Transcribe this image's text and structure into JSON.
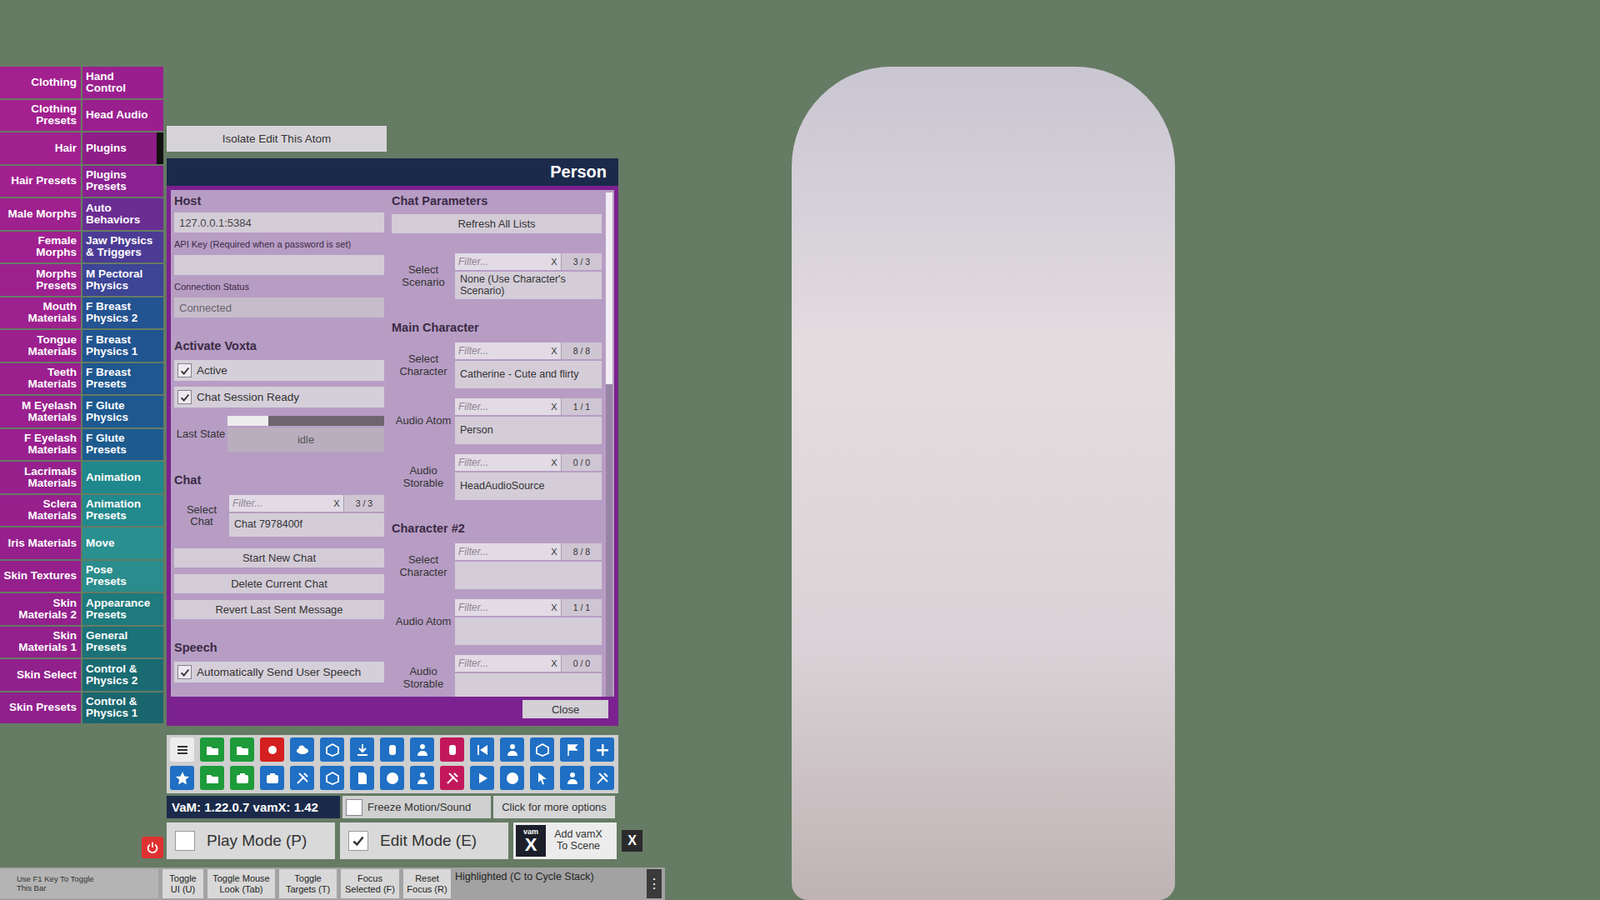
{
  "tabs": {
    "left": [
      {
        "label": "Clothing",
        "selected": false,
        "color": "#a3208f"
      },
      {
        "label": "Clothing Presets",
        "selected": false,
        "color": "#a3208f"
      },
      {
        "label": "Hair",
        "selected": false,
        "color": "#a1208f"
      },
      {
        "label": "Hair Presets",
        "selected": false,
        "color": "#a1208f"
      },
      {
        "label": "Male Morphs",
        "selected": false,
        "color": "#9f208f"
      },
      {
        "label": "Female Morphs",
        "selected": false,
        "color": "#9f208f"
      },
      {
        "label": "Morphs Presets",
        "selected": false,
        "color": "#9d208f"
      },
      {
        "label": "Mouth Materials",
        "selected": false,
        "color": "#9d208f"
      },
      {
        "label": "Tongue Materials",
        "selected": false,
        "color": "#9b208e"
      },
      {
        "label": "Teeth Materials",
        "selected": false,
        "color": "#9b208e"
      },
      {
        "label": "M Eyelash Materials",
        "selected": false,
        "color": "#99208e"
      },
      {
        "label": "F Eyelash Materials",
        "selected": false,
        "color": "#99208e"
      },
      {
        "label": "Lacrimals Materials",
        "selected": false,
        "color": "#97208d"
      },
      {
        "label": "Sclera Materials",
        "selected": false,
        "color": "#97208d"
      },
      {
        "label": "Iris Materials",
        "selected": false,
        "color": "#95208d"
      },
      {
        "label": "Skin Textures",
        "selected": false,
        "color": "#95208d"
      },
      {
        "label": "Skin Materials 2",
        "selected": false,
        "color": "#93208c"
      },
      {
        "label": "Skin Materials 1",
        "selected": false,
        "color": "#93208c"
      },
      {
        "label": "Skin Select",
        "selected": false,
        "color": "#91208c"
      },
      {
        "label": "Skin Presets",
        "selected": false,
        "color": "#91208c"
      }
    ],
    "right": [
      {
        "label": "Hand Control",
        "selected": false,
        "color": "#9a1f8e"
      },
      {
        "label": "Head Audio",
        "selected": false,
        "color": "#9a1f8e"
      },
      {
        "label": "Plugins",
        "selected": true,
        "color": "#8e1d88"
      },
      {
        "label": "Plugins Presets",
        "selected": false,
        "color": "#8a2190"
      },
      {
        "label": "Auto Behaviors",
        "selected": false,
        "color": "#6a2d92"
      },
      {
        "label": "Jaw Physics & Triggers",
        "selected": false,
        "color": "#4c3b95"
      },
      {
        "label": "M Pectoral Physics",
        "selected": false,
        "color": "#3c4596"
      },
      {
        "label": "F Breast Physics 2",
        "selected": false,
        "color": "#245391"
      },
      {
        "label": "F Breast Physics 1",
        "selected": false,
        "color": "#215591"
      },
      {
        "label": "F Breast Presets",
        "selected": false,
        "color": "#1f5790"
      },
      {
        "label": "F Glute Physics",
        "selected": false,
        "color": "#1d598f"
      },
      {
        "label": "F Glute Presets",
        "selected": false,
        "color": "#1d5b8f"
      },
      {
        "label": "Animation",
        "selected": false,
        "color": "#1f888c"
      },
      {
        "label": "Animation Presets",
        "selected": false,
        "color": "#22898c"
      },
      {
        "label": "Move",
        "selected": false,
        "color": "#2a8f8f"
      },
      {
        "label": "Pose Presets",
        "selected": false,
        "color": "#2a8c8c"
      },
      {
        "label": "Appearance Presets",
        "selected": false,
        "color": "#1e7a7c"
      },
      {
        "label": "General Presets",
        "selected": false,
        "color": "#1c7277"
      },
      {
        "label": "Control & Physics 2",
        "selected": false,
        "color": "#1a6a71"
      },
      {
        "label": "Control & Physics 1",
        "selected": false,
        "color": "#1a666e"
      }
    ]
  },
  "isolate_button": "Isolate Edit This Atom",
  "panel": {
    "title": "Person",
    "scrollbar": {
      "level": 0.38
    },
    "close": "Close",
    "left": [
      {
        "kind": "heading",
        "text": "Host"
      },
      {
        "kind": "field",
        "value": "127.0.0.1:5384",
        "disabled": false
      },
      {
        "kind": "caption",
        "text": "API Key (Required when a password is set)"
      },
      {
        "kind": "field",
        "value": "",
        "disabled": false
      },
      {
        "kind": "caption",
        "text": "Connection Status"
      },
      {
        "kind": "field",
        "value": "Connected",
        "disabled": true
      },
      {
        "kind": "heading",
        "text": "Activate Voxta"
      },
      {
        "kind": "checkbox",
        "label": "Active",
        "checked": true
      },
      {
        "kind": "checkbox",
        "label": "Chat Session Ready",
        "checked": true
      },
      {
        "kind": "slider",
        "label": "Last State",
        "level": 0.26,
        "value": "idle"
      },
      {
        "kind": "heading",
        "text": "Chat"
      },
      {
        "kind": "chooser",
        "label": "Select Chat",
        "filter": "Filter...",
        "clear": "X",
        "count": "3 / 3",
        "value": "Chat 7978400f"
      },
      {
        "kind": "button",
        "label": "Start New Chat"
      },
      {
        "kind": "button",
        "label": "Delete Current Chat"
      },
      {
        "kind": "button",
        "label": "Revert Last Sent Message"
      },
      {
        "kind": "heading",
        "text": "Speech"
      },
      {
        "kind": "checkbox",
        "label": "Automatically Send User Speech",
        "checked": true
      }
    ],
    "right": [
      {
        "kind": "heading",
        "text": "Chat Parameters"
      },
      {
        "kind": "button",
        "label": "Refresh All Lists"
      },
      {
        "kind": "chooser",
        "label": "Select Scenario",
        "filter": "Filter...",
        "clear": "X",
        "count": "3 / 3",
        "value": "None (Use Character's Scenario)"
      },
      {
        "kind": "heading",
        "text": "Main Character"
      },
      {
        "kind": "chooser",
        "label": "Select Character",
        "filter": "Filter...",
        "clear": "X",
        "count": "8 / 8",
        "value": "Catherine - Cute and flirty"
      },
      {
        "kind": "chooser",
        "label": "Audio Atom",
        "filter": "Filter...",
        "clear": "X",
        "count": "1 / 1",
        "value": "Person"
      },
      {
        "kind": "chooser",
        "label": "Audio Storable",
        "filter": "Filter...",
        "clear": "X",
        "count": "0 / 0",
        "value": "HeadAudioSource"
      },
      {
        "kind": "heading",
        "text": "Character #2"
      },
      {
        "kind": "chooser",
        "label": "Select Character",
        "filter": "Filter...",
        "clear": "X",
        "count": "8 / 8",
        "value": ""
      },
      {
        "kind": "chooser",
        "label": "Audio Atom",
        "filter": "Filter...",
        "clear": "X",
        "count": "1 / 1",
        "value": ""
      },
      {
        "kind": "chooser",
        "label": "Audio Storable",
        "filter": "Filter...",
        "clear": "X",
        "count": "0 / 0",
        "value": ""
      }
    ]
  },
  "toolbar": {
    "rows": [
      [
        {
          "color": "#ececec"
        },
        {
          "color": "#1e9b3a"
        },
        {
          "color": "#1e9b3a"
        },
        {
          "color": "#d42020"
        },
        {
          "color": "#1f6fc4"
        },
        {
          "color": "#1f6fc4"
        },
        {
          "color": "#1f6fc4"
        },
        {
          "color": "#1f6fc4"
        },
        {
          "color": "#1f6fc4"
        },
        {
          "color": "#c2185b"
        },
        {
          "color": "#1f6fc4"
        },
        {
          "color": "#1f6fc4"
        },
        {
          "color": "#1f6fc4"
        },
        {
          "color": "#1f6fc4"
        },
        {
          "color": "#1f6fc4"
        }
      ],
      [
        {
          "color": "#1f6fc4"
        },
        {
          "color": "#1e9b3a"
        },
        {
          "color": "#1e9b3a"
        },
        {
          "color": "#1f6fc4"
        },
        {
          "color": "#1f6fc4"
        },
        {
          "color": "#1f6fc4"
        },
        {
          "color": "#1f6fc4"
        },
        {
          "color": "#1f6fc4"
        },
        {
          "color": "#1f6fc4"
        },
        {
          "color": "#c2185b"
        },
        {
          "color": "#1f6fc4"
        },
        {
          "color": "#1f6fc4"
        },
        {
          "color": "#1f6fc4"
        },
        {
          "color": "#1f6fc4"
        },
        {
          "color": "#1f6fc4"
        }
      ]
    ]
  },
  "vam_bar": {
    "version": "VaM: 1.22.0.7 vamX: 1.42",
    "freeze": {
      "label": "Freeze Motion/Sound",
      "checked": false
    },
    "more_options": "Click for more options"
  },
  "modes": [
    {
      "label": "Play Mode (P)",
      "checked": false
    },
    {
      "label": "Edit Mode (E)",
      "checked": true
    }
  ],
  "vamx": {
    "logo_top": "vam",
    "logo_letter": "X",
    "label": "Add vamX To Scene",
    "close": "X"
  },
  "bottom_bar": {
    "hint": "Use F1 Key To Toggle This Bar",
    "buttons": [
      "Toggle UI (U)",
      "Toggle Mouse Look (Tab)",
      "Toggle Targets (T)",
      "Focus Selected (F)",
      "Reset Focus (R)"
    ],
    "status": "Highlighted (C to Cycle Stack)",
    "menu": "⋮"
  }
}
